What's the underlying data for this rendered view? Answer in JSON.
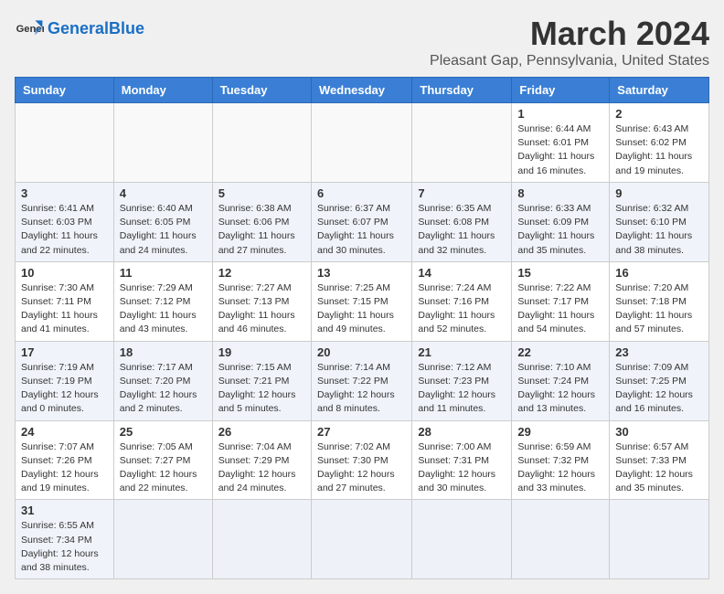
{
  "header": {
    "logo_general": "General",
    "logo_blue": "Blue",
    "month_title": "March 2024",
    "location": "Pleasant Gap, Pennsylvania, United States"
  },
  "weekdays": [
    "Sunday",
    "Monday",
    "Tuesday",
    "Wednesday",
    "Thursday",
    "Friday",
    "Saturday"
  ],
  "rows": [
    [
      {
        "day": "",
        "info": ""
      },
      {
        "day": "",
        "info": ""
      },
      {
        "day": "",
        "info": ""
      },
      {
        "day": "",
        "info": ""
      },
      {
        "day": "",
        "info": ""
      },
      {
        "day": "1",
        "info": "Sunrise: 6:44 AM\nSunset: 6:01 PM\nDaylight: 11 hours and 16 minutes."
      },
      {
        "day": "2",
        "info": "Sunrise: 6:43 AM\nSunset: 6:02 PM\nDaylight: 11 hours and 19 minutes."
      }
    ],
    [
      {
        "day": "3",
        "info": "Sunrise: 6:41 AM\nSunset: 6:03 PM\nDaylight: 11 hours and 22 minutes."
      },
      {
        "day": "4",
        "info": "Sunrise: 6:40 AM\nSunset: 6:05 PM\nDaylight: 11 hours and 24 minutes."
      },
      {
        "day": "5",
        "info": "Sunrise: 6:38 AM\nSunset: 6:06 PM\nDaylight: 11 hours and 27 minutes."
      },
      {
        "day": "6",
        "info": "Sunrise: 6:37 AM\nSunset: 6:07 PM\nDaylight: 11 hours and 30 minutes."
      },
      {
        "day": "7",
        "info": "Sunrise: 6:35 AM\nSunset: 6:08 PM\nDaylight: 11 hours and 32 minutes."
      },
      {
        "day": "8",
        "info": "Sunrise: 6:33 AM\nSunset: 6:09 PM\nDaylight: 11 hours and 35 minutes."
      },
      {
        "day": "9",
        "info": "Sunrise: 6:32 AM\nSunset: 6:10 PM\nDaylight: 11 hours and 38 minutes."
      }
    ],
    [
      {
        "day": "10",
        "info": "Sunrise: 7:30 AM\nSunset: 7:11 PM\nDaylight: 11 hours and 41 minutes."
      },
      {
        "day": "11",
        "info": "Sunrise: 7:29 AM\nSunset: 7:12 PM\nDaylight: 11 hours and 43 minutes."
      },
      {
        "day": "12",
        "info": "Sunrise: 7:27 AM\nSunset: 7:13 PM\nDaylight: 11 hours and 46 minutes."
      },
      {
        "day": "13",
        "info": "Sunrise: 7:25 AM\nSunset: 7:15 PM\nDaylight: 11 hours and 49 minutes."
      },
      {
        "day": "14",
        "info": "Sunrise: 7:24 AM\nSunset: 7:16 PM\nDaylight: 11 hours and 52 minutes."
      },
      {
        "day": "15",
        "info": "Sunrise: 7:22 AM\nSunset: 7:17 PM\nDaylight: 11 hours and 54 minutes."
      },
      {
        "day": "16",
        "info": "Sunrise: 7:20 AM\nSunset: 7:18 PM\nDaylight: 11 hours and 57 minutes."
      }
    ],
    [
      {
        "day": "17",
        "info": "Sunrise: 7:19 AM\nSunset: 7:19 PM\nDaylight: 12 hours and 0 minutes."
      },
      {
        "day": "18",
        "info": "Sunrise: 7:17 AM\nSunset: 7:20 PM\nDaylight: 12 hours and 2 minutes."
      },
      {
        "day": "19",
        "info": "Sunrise: 7:15 AM\nSunset: 7:21 PM\nDaylight: 12 hours and 5 minutes."
      },
      {
        "day": "20",
        "info": "Sunrise: 7:14 AM\nSunset: 7:22 PM\nDaylight: 12 hours and 8 minutes."
      },
      {
        "day": "21",
        "info": "Sunrise: 7:12 AM\nSunset: 7:23 PM\nDaylight: 12 hours and 11 minutes."
      },
      {
        "day": "22",
        "info": "Sunrise: 7:10 AM\nSunset: 7:24 PM\nDaylight: 12 hours and 13 minutes."
      },
      {
        "day": "23",
        "info": "Sunrise: 7:09 AM\nSunset: 7:25 PM\nDaylight: 12 hours and 16 minutes."
      }
    ],
    [
      {
        "day": "24",
        "info": "Sunrise: 7:07 AM\nSunset: 7:26 PM\nDaylight: 12 hours and 19 minutes."
      },
      {
        "day": "25",
        "info": "Sunrise: 7:05 AM\nSunset: 7:27 PM\nDaylight: 12 hours and 22 minutes."
      },
      {
        "day": "26",
        "info": "Sunrise: 7:04 AM\nSunset: 7:29 PM\nDaylight: 12 hours and 24 minutes."
      },
      {
        "day": "27",
        "info": "Sunrise: 7:02 AM\nSunset: 7:30 PM\nDaylight: 12 hours and 27 minutes."
      },
      {
        "day": "28",
        "info": "Sunrise: 7:00 AM\nSunset: 7:31 PM\nDaylight: 12 hours and 30 minutes."
      },
      {
        "day": "29",
        "info": "Sunrise: 6:59 AM\nSunset: 7:32 PM\nDaylight: 12 hours and 33 minutes."
      },
      {
        "day": "30",
        "info": "Sunrise: 6:57 AM\nSunset: 7:33 PM\nDaylight: 12 hours and 35 minutes."
      }
    ],
    [
      {
        "day": "31",
        "info": "Sunrise: 6:55 AM\nSunset: 7:34 PM\nDaylight: 12 hours and 38 minutes."
      },
      {
        "day": "",
        "info": ""
      },
      {
        "day": "",
        "info": ""
      },
      {
        "day": "",
        "info": ""
      },
      {
        "day": "",
        "info": ""
      },
      {
        "day": "",
        "info": ""
      },
      {
        "day": "",
        "info": ""
      }
    ]
  ]
}
